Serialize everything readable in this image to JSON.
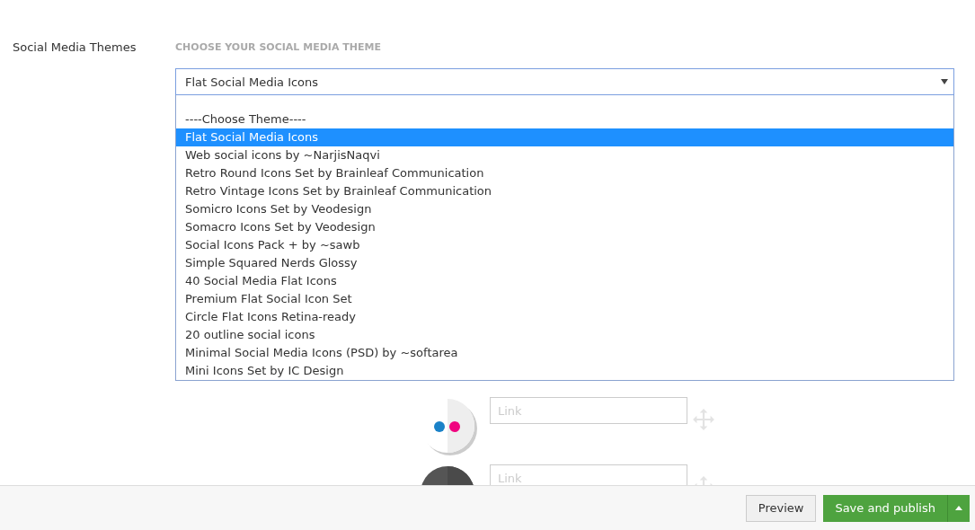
{
  "section_label": "Social Media Themes",
  "theme_heading": "CHOOSE YOUR SOCIAL MEDIA THEME",
  "theme_select": {
    "value": "Flat Social Media Icons",
    "expanded": true,
    "options": [
      {
        "label": "----Choose Theme----",
        "selected": false
      },
      {
        "label": "Flat Social Media Icons",
        "selected": true
      },
      {
        "label": "Web social icons by ~NarjisNaqvi",
        "selected": false
      },
      {
        "label": "Retro Round Icons Set by Brainleaf Communication",
        "selected": false
      },
      {
        "label": "Retro Vintage Icons Set by Brainleaf Communication",
        "selected": false
      },
      {
        "label": "Somicro Icons Set by Veodesign",
        "selected": false
      },
      {
        "label": "Somacro Icons Set by Veodesign",
        "selected": false
      },
      {
        "label": "Social Icons Pack + by ~sawb",
        "selected": false
      },
      {
        "label": "Simple Squared Nerds Glossy",
        "selected": false
      },
      {
        "label": "40 Social Media Flat Icons",
        "selected": false
      },
      {
        "label": "Premium Flat Social Icon Set",
        "selected": false
      },
      {
        "label": "Circle Flat Icons Retina-ready",
        "selected": false
      },
      {
        "label": "20 outline social icons",
        "selected": false
      },
      {
        "label": "Minimal Social Media Icons (PSD) by ~softarea",
        "selected": false
      },
      {
        "label": "Mini Icons Set by IC Design",
        "selected": false
      }
    ]
  },
  "social_links": [
    {
      "kind": "flickr",
      "placeholder": "Link"
    },
    {
      "kind": "dark",
      "placeholder": "Link"
    }
  ],
  "footer": {
    "preview": "Preview",
    "publish": "Save and publish"
  }
}
